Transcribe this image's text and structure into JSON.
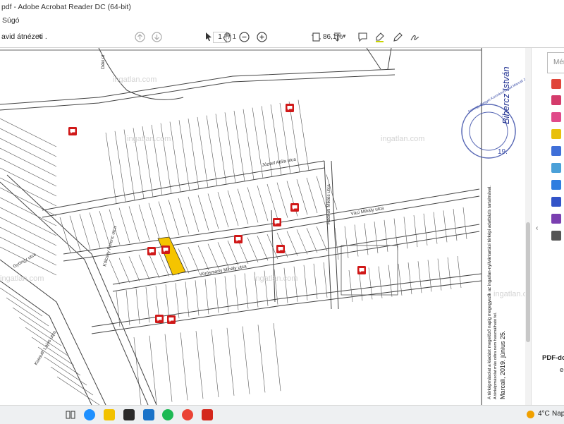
{
  "window": {
    "title": "pdf - Adobe Acrobat Reader DC (64-bit)"
  },
  "menu": {
    "help": "Súgó"
  },
  "tab": {
    "label": "avid átnézeti ...",
    "close": "×"
  },
  "toolbar": {
    "page_current": "1",
    "page_total": "/ 1",
    "zoom": "86,1%",
    "zoom_dropdown": "▾"
  },
  "map": {
    "watermarks": [
      "ingatlan.com",
      "ingatlan.com",
      "ingatlan.com",
      "ingatlan.com",
      "ingatlan.com",
      "ingatlan.com"
    ],
    "streets": {
      "jozsef_attila": "József Attila utca",
      "vaci_mihaly": "Váci Mihály utca",
      "vorosmarty": "Vörösmarty Mihály utca",
      "deki": "Déki út",
      "kolcsey": "Kölcsey Ferenc utca",
      "kolcsey_ferenc": "Kölcsey Ferenc utca",
      "radnoti": "Radnóti Miklós utca",
      "kossuth": "Kossuth Lajos utca",
      "gyongy": "Gyöngy utca"
    },
    "signature": "Bihercz István",
    "stamp_number": "19.",
    "note_lines": [
      "A térképmásolat a kiadást megelőző napig megegyezik az ingatlan-nyilvántartási térképi adatbázis tartalmával.",
      "A térképmásolat más célra nem használható fel.",
      "Marcali, 2019. június 25."
    ],
    "stamp_text": "Somogy Megyei Kormányhivatal Marcali Járási Hivatala"
  },
  "right_panel": {
    "search_placeholder": "Mér",
    "pdf_label": "PDF-doku",
    "pdf_sub": "e-",
    "collapse": "‹"
  },
  "taskbar": {
    "weather_temp": "4°C",
    "weather_text": "Napo"
  },
  "colors": {
    "highlight_parcel": "#f5c400",
    "comment_marker": "#d01818",
    "acrobat_red": "#d4271c",
    "stamp_blue": "#3b4ea8",
    "signature_blue": "#1c2d8f"
  }
}
